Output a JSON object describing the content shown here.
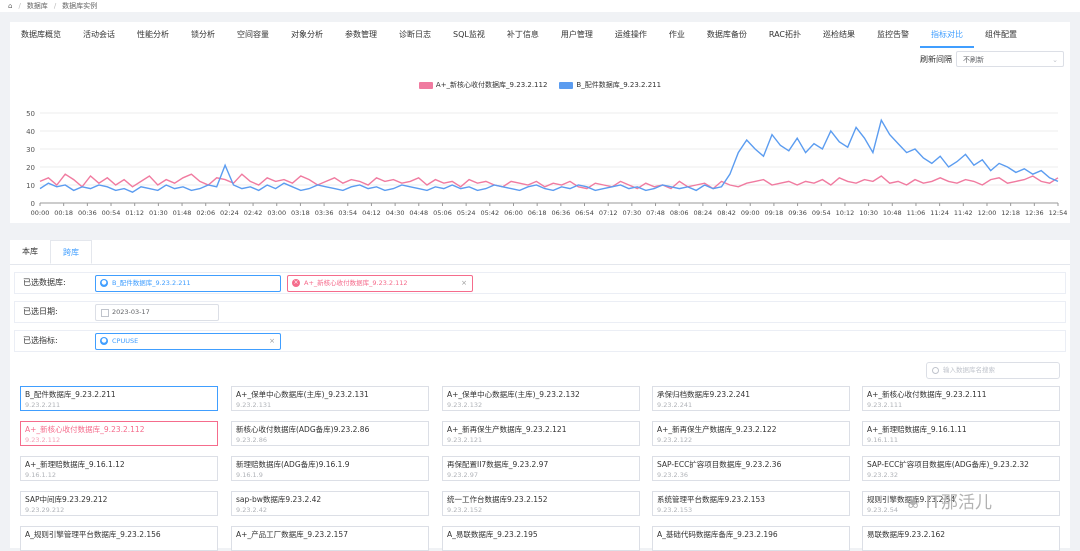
{
  "breadcrumb": {
    "home_icon": "home-icon",
    "items": [
      "数据库",
      "数据库实例"
    ]
  },
  "tabs": [
    "数据库概览",
    "活动会话",
    "性能分析",
    "锁分析",
    "空间容量",
    "对象分析",
    "参数管理",
    "诊断日志",
    "SQL监视",
    "补丁信息",
    "用户管理",
    "运维操作",
    "作业",
    "数据库备份",
    "RAC拓扑",
    "巡检结果",
    "监控告警",
    "指标对比",
    "组件配置"
  ],
  "active_tab": "指标对比",
  "refresh": {
    "label": "刷新间隔",
    "value": "不刷新"
  },
  "chart_data": {
    "type": "line",
    "title": "",
    "ylim": [
      0,
      55
    ],
    "yticks": [
      0,
      10,
      20,
      30,
      40,
      50
    ],
    "xtick_labels": [
      "00:00",
      "00:18",
      "00:36",
      "00:54",
      "01:12",
      "01:30",
      "01:48",
      "02:06",
      "02:24",
      "02:42",
      "03:00",
      "03:18",
      "03:36",
      "03:54",
      "04:12",
      "04:30",
      "04:48",
      "05:06",
      "05:24",
      "05:42",
      "06:00",
      "06:18",
      "06:36",
      "06:54",
      "07:12",
      "07:30",
      "07:48",
      "08:06",
      "08:24",
      "08:42",
      "09:00",
      "09:18",
      "09:36",
      "09:54",
      "10:12",
      "10:30",
      "10:48",
      "11:06",
      "11:24",
      "11:42",
      "12:00",
      "12:18",
      "12:36",
      "12:54"
    ],
    "grid": true,
    "legend": "top-center",
    "series": [
      {
        "name": "A+_新核心收付数据库_9.23.2.112",
        "color": "#f07ba0",
        "values": [
          12,
          14,
          10,
          16,
          13,
          9,
          15,
          11,
          14,
          10,
          13,
          9,
          12,
          15,
          10,
          13,
          11,
          14,
          16,
          12,
          10,
          14,
          13,
          11,
          16,
          12,
          10,
          14,
          12,
          13,
          11,
          15,
          13,
          10,
          12,
          14,
          11,
          13,
          12,
          10,
          14,
          12,
          13,
          11,
          12,
          14,
          10,
          13,
          11,
          12,
          9,
          13,
          11,
          12,
          10,
          9,
          12,
          11,
          10,
          12,
          9,
          11,
          10,
          12,
          9,
          8,
          11,
          10,
          9,
          12,
          10,
          8,
          11,
          9,
          10,
          8,
          12,
          9,
          10,
          11,
          8,
          12,
          10,
          9,
          11,
          12,
          13,
          10,
          11,
          12,
          10,
          12,
          11,
          13,
          10,
          14,
          12,
          11,
          13,
          12,
          15,
          11,
          12,
          10,
          13,
          11,
          12,
          14,
          12,
          11,
          13,
          12,
          10,
          13,
          14,
          11,
          12,
          13,
          15,
          12,
          11,
          14
        ]
      },
      {
        "name": "B_配件数据库_9.23.2.211",
        "color": "#5b9cf0",
        "values": [
          8,
          11,
          9,
          10,
          7,
          9,
          8,
          10,
          9,
          7,
          8,
          6,
          9,
          8,
          7,
          10,
          8,
          9,
          7,
          8,
          10,
          9,
          21,
          10,
          8,
          9,
          7,
          10,
          8,
          11,
          9,
          7,
          8,
          10,
          9,
          8,
          7,
          9,
          10,
          8,
          9,
          7,
          8,
          10,
          9,
          8,
          7,
          9,
          8,
          10,
          8,
          9,
          7,
          8,
          10,
          9,
          8,
          7,
          9,
          10,
          8,
          7,
          9,
          8,
          10,
          9,
          7,
          8,
          9,
          10,
          8,
          9,
          7,
          8,
          10,
          9,
          8,
          9,
          7,
          10,
          8,
          9,
          16,
          28,
          35,
          30,
          26,
          38,
          32,
          29,
          36,
          28,
          33,
          30,
          40,
          34,
          31,
          42,
          36,
          28,
          46,
          38,
          33,
          28,
          30,
          25,
          22,
          26,
          20,
          23,
          27,
          21,
          24,
          18,
          22,
          20,
          17,
          19,
          16,
          18,
          14,
          12
        ]
      }
    ]
  },
  "subtabs": [
    "本库",
    "跨库"
  ],
  "active_subtab": "跨库",
  "filters": {
    "selected_db_label": "已选数据库:",
    "selected_dbs": [
      "B_配件数据库_9.23.2.211",
      "A+_新核心收付数据库_9.23.2.112"
    ],
    "date_label": "已选日期:",
    "date_value": "2023-03-17",
    "metric_label": "已选指标:",
    "metric_value": "CPUUSE"
  },
  "search": {
    "placeholder": "输入数据库名搜索"
  },
  "db_cards": [
    {
      "name": "B_配件数据库_9.23.2.211",
      "ip": "9.23.2.211",
      "selected": "blue"
    },
    {
      "name": "A+_保单中心数据库(主库)_9.23.2.131",
      "ip": "9.23.2.131"
    },
    {
      "name": "A+_保单中心数据库(主库)_9.23.2.132",
      "ip": "9.23.2.132"
    },
    {
      "name": "承保归档数据库9.23.2.241",
      "ip": "9.23.2.241"
    },
    {
      "name": "A+_新核心收付数据库_9.23.2.111",
      "ip": "9.23.2.111"
    },
    {
      "name": "A+_新核心收付数据库_9.23.2.112",
      "ip": "9.23.2.112",
      "selected": "pink"
    },
    {
      "name": "新核心收付数据库(ADG备库)9.23.2.86",
      "ip": "9.23.2.86"
    },
    {
      "name": "A+_新再保生产数据库_9.23.2.121",
      "ip": "9.23.2.121"
    },
    {
      "name": "A+_新再保生产数据库_9.23.2.122",
      "ip": "9.23.2.122"
    },
    {
      "name": "A+_新理赔数据库_9.16.1.11",
      "ip": "9.16.1.11"
    },
    {
      "name": "A+_新理赔数据库_9.16.1.12",
      "ip": "9.16.1.12"
    },
    {
      "name": "新理赔数据库(ADG备库)9.16.1.9",
      "ip": "9.16.1.9"
    },
    {
      "name": "再保配置II7数据库_9.23.2.97",
      "ip": "9.23.2.97"
    },
    {
      "name": "SAP-ECC扩容项目数据库_9.23.2.36",
      "ip": "9.23.2.36"
    },
    {
      "name": "SAP-ECC扩容项目数据库(ADG备库)_9.23.2.32",
      "ip": "9.23.2.32"
    },
    {
      "name": "SAP中间库9.23.29.212",
      "ip": "9.23.29.212"
    },
    {
      "name": "sap-bw数据库9.23.2.42",
      "ip": "9.23.2.42"
    },
    {
      "name": "统一工作台数据库9.23.2.152",
      "ip": "9.23.2.152"
    },
    {
      "name": "系统管理平台数据库9.23.2.153",
      "ip": "9.23.2.153"
    },
    {
      "name": "规则引擎数据库9.23.2.54",
      "ip": "9.23.2.54"
    },
    {
      "name": "A_规则引擎管理平台数据库_9.23.2.156",
      "ip": ""
    },
    {
      "name": "A+_产品工厂数据库_9.23.2.157",
      "ip": ""
    },
    {
      "name": "A_易联数据库_9.23.2.195",
      "ip": ""
    },
    {
      "name": "A_基础代码数据库备库_9.23.2.196",
      "ip": ""
    },
    {
      "name": "易联数据库9.23.2.162",
      "ip": ""
    }
  ],
  "watermark": "IT那活儿"
}
